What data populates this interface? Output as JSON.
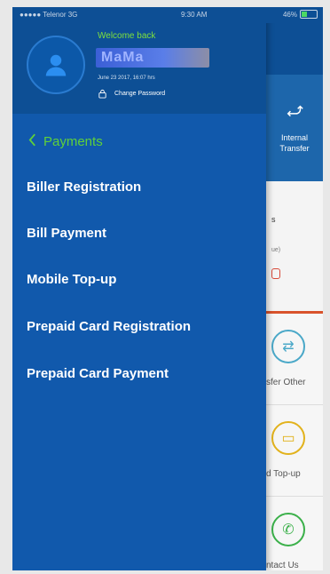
{
  "status_bar": {
    "carrier": "●●●●● Telenor  3G",
    "time": "9:30 AM",
    "battery": "46%"
  },
  "drawer": {
    "welcome": "Welcome back",
    "username": "MaMa",
    "last_login": "June 23 2017, 16:07 hrs",
    "change_password": "Change Password",
    "back_label": "Payments",
    "items": [
      {
        "label": "Biller Registration"
      },
      {
        "label": "Bill Payment"
      },
      {
        "label": "Mobile Top-up"
      },
      {
        "label": "Prepaid Card Registration"
      },
      {
        "label": "Prepaid Card Payment"
      }
    ]
  },
  "background": {
    "transfer_label_1": "Internal",
    "transfer_label_2": "Transfer",
    "transfer_other": "sfer Other",
    "mobile_topup": "d Top-up",
    "contact_us": "ntact Us",
    "mid_text_1": "s",
    "mid_text_2": "ue)"
  },
  "colors": {
    "accent_green": "#5fd13a",
    "drawer_blue": "#1159ac",
    "header_blue": "#0d4f95"
  }
}
